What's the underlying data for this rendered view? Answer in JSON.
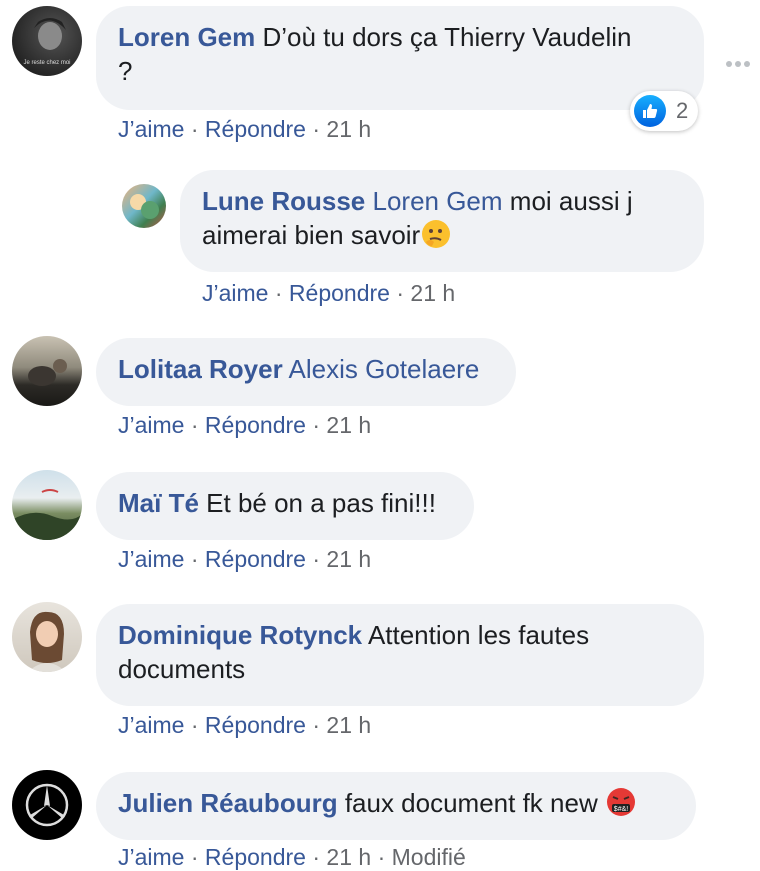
{
  "comments": [
    {
      "author": "Loren Gem",
      "text_line1": "D’où tu dors ça Thierry Vaudelin",
      "text_line2": "?",
      "actions": {
        "like": "J’aime",
        "reply": "Répondre",
        "time": "21 h"
      },
      "reaction_count": "2",
      "avatar_caption": "Je reste chez moi"
    },
    {
      "author": "Lune Rousse",
      "mention": "Loren Gem",
      "text_line1": "moi aussi j",
      "text_line2": "aimerai bien savoir",
      "emoji": "thinking-face",
      "actions": {
        "like": "J’aime",
        "reply": "Répondre",
        "time": "21 h"
      }
    },
    {
      "author": "Lolitaa Royer",
      "mention": "Alexis Gotelaere",
      "actions": {
        "like": "J’aime",
        "reply": "Répondre",
        "time": "21 h"
      }
    },
    {
      "author": "Maï Té",
      "text": "Et bé on a pas fini!!!",
      "actions": {
        "like": "J’aime",
        "reply": "Répondre",
        "time": "21 h"
      }
    },
    {
      "author": "Dominique Rotynck",
      "text_line1": "Attention les fautes",
      "text_line2": "documents",
      "actions": {
        "like": "J’aime",
        "reply": "Répondre",
        "time": "21 h"
      }
    },
    {
      "author": "Julien Réaubourg",
      "text": "faux document fk new",
      "emoji": "face-with-symbols",
      "actions": {
        "like": "J’aime",
        "reply": "Répondre",
        "time": "21 h",
        "edited": "Modifié"
      }
    }
  ],
  "separator": "·",
  "colors": {
    "link": "#385898",
    "bubble": "#f0f2f5",
    "meta": "#65676b",
    "like_blue": "#1877f2"
  }
}
